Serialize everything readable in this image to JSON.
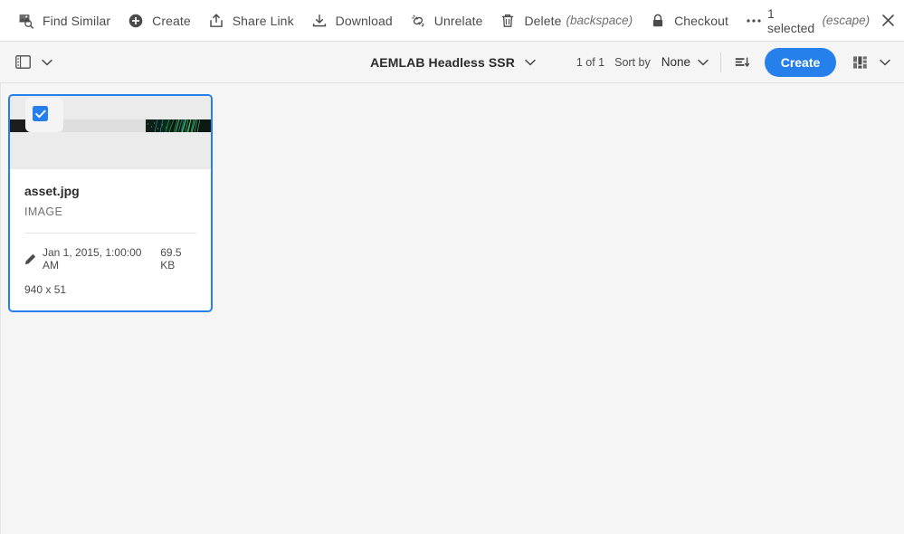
{
  "action_bar": {
    "actions": [
      {
        "id": "find-similar",
        "label": "Find Similar",
        "icon": "find-similar-icon",
        "hint": ""
      },
      {
        "id": "create",
        "label": "Create",
        "icon": "create-circle-icon",
        "hint": ""
      },
      {
        "id": "share-link",
        "label": "Share Link",
        "icon": "share-link-icon",
        "hint": ""
      },
      {
        "id": "download",
        "label": "Download",
        "icon": "download-icon",
        "hint": ""
      },
      {
        "id": "unrelate",
        "label": "Unrelate",
        "icon": "unrelate-broken-link-icon",
        "hint": ""
      },
      {
        "id": "delete",
        "label": "Delete",
        "icon": "trash-icon",
        "hint": "(backspace)"
      },
      {
        "id": "checkout",
        "label": "Checkout",
        "icon": "lock-icon",
        "hint": ""
      }
    ],
    "more_icon": "more-ellipsis-icon",
    "selection_label": "1 selected",
    "selection_hint": "(escape)",
    "close_icon": "close-icon"
  },
  "toolbar": {
    "rail_toggle_icon": "show-rail-icon",
    "rail_chevron_icon": "chevron-down-icon",
    "title": "AEMLAB Headless SSR",
    "title_chevron_icon": "chevron-down-icon",
    "count_label": "1 of 1",
    "sort_by_label": "Sort by",
    "sort_value": "None",
    "sort_options": [
      "None"
    ],
    "sort_chevron_icon": "chevron-down-icon",
    "sort_order_icon": "sort-order-icon",
    "create_label": "Create",
    "view_icon": "view-layout-icon",
    "view_chevron_icon": "chevron-down-icon",
    "accent_color": "#2680eb"
  },
  "assets": [
    {
      "selected": true,
      "checkbox_icon": "checkmark-icon",
      "title": "asset.jpg",
      "type": "IMAGE",
      "modified_icon": "pencil-edit-icon",
      "modified": "Jan 1, 2015, 1:00:00 AM",
      "size": "69.5 KB",
      "dimensions": "940 x 51"
    }
  ]
}
